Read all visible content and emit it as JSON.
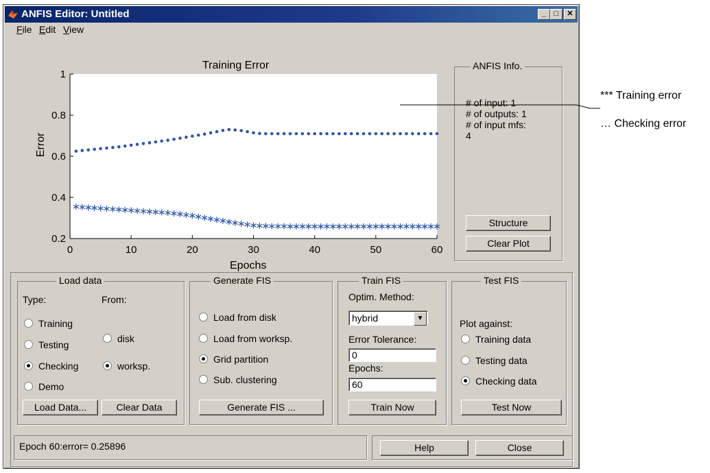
{
  "window": {
    "title": "ANFIS Editor: Untitled",
    "controls": {
      "minimize": "_",
      "maximize": "□",
      "close": "✕"
    }
  },
  "menu": [
    {
      "underline": "F",
      "rest": "ile"
    },
    {
      "underline": "E",
      "rest": "dit"
    },
    {
      "underline": "V",
      "rest": "iew"
    }
  ],
  "chart_data": {
    "type": "scatter",
    "title": "Training Error",
    "xlabel": "Epochs",
    "ylabel": "Error",
    "xlim": [
      0,
      60
    ],
    "ylim": [
      0.2,
      1
    ],
    "x_ticks": [
      "0",
      "10",
      "20",
      "30",
      "40",
      "50",
      "60"
    ],
    "y_ticks": [
      "0.2",
      "0.4",
      "0.6",
      "0.8",
      "1"
    ],
    "grid": false,
    "series": [
      {
        "marker": "dot",
        "color": "#2e55a8",
        "x": [
          1,
          2,
          3,
          4,
          5,
          6,
          7,
          8,
          9,
          10,
          11,
          12,
          13,
          14,
          15,
          16,
          17,
          18,
          19,
          20,
          21,
          22,
          23,
          24,
          25,
          26,
          27,
          28,
          29,
          30,
          31,
          32,
          33,
          34,
          35,
          36,
          37,
          38,
          39,
          40,
          41,
          42,
          43,
          44,
          45,
          46,
          47,
          48,
          49,
          50,
          51,
          52,
          53,
          54,
          55,
          56,
          57,
          58,
          59,
          60
        ],
        "values": [
          0.625,
          0.628,
          0.631,
          0.634,
          0.637,
          0.64,
          0.643,
          0.646,
          0.65,
          0.654,
          0.658,
          0.662,
          0.666,
          0.67,
          0.674,
          0.678,
          0.683,
          0.688,
          0.693,
          0.698,
          0.703,
          0.708,
          0.714,
          0.72,
          0.726,
          0.73,
          0.728,
          0.725,
          0.72,
          0.714,
          0.711,
          0.71,
          0.71,
          0.71,
          0.71,
          0.71,
          0.71,
          0.71,
          0.71,
          0.71,
          0.71,
          0.71,
          0.71,
          0.71,
          0.71,
          0.71,
          0.71,
          0.71,
          0.71,
          0.71,
          0.71,
          0.71,
          0.71,
          0.71,
          0.71,
          0.71,
          0.71,
          0.71,
          0.71,
          0.71
        ]
      },
      {
        "marker": "asterisk",
        "color": "#2e55a8",
        "x": [
          1,
          2,
          3,
          4,
          5,
          6,
          7,
          8,
          9,
          10,
          11,
          12,
          13,
          14,
          15,
          16,
          17,
          18,
          19,
          20,
          21,
          22,
          23,
          24,
          25,
          26,
          27,
          28,
          29,
          30,
          31,
          32,
          33,
          34,
          35,
          36,
          37,
          38,
          39,
          40,
          41,
          42,
          43,
          44,
          45,
          46,
          47,
          48,
          49,
          50,
          51,
          52,
          53,
          54,
          55,
          56,
          57,
          58,
          59,
          60
        ],
        "values": [
          0.355,
          0.353,
          0.351,
          0.349,
          0.347,
          0.345,
          0.343,
          0.341,
          0.339,
          0.337,
          0.335,
          0.333,
          0.331,
          0.329,
          0.327,
          0.325,
          0.322,
          0.319,
          0.315,
          0.311,
          0.306,
          0.301,
          0.296,
          0.291,
          0.286,
          0.281,
          0.276,
          0.272,
          0.268,
          0.264,
          0.262,
          0.261,
          0.26,
          0.26,
          0.26,
          0.259,
          0.259,
          0.259,
          0.259,
          0.259,
          0.259,
          0.259,
          0.259,
          0.259,
          0.259,
          0.259,
          0.259,
          0.259,
          0.259,
          0.259,
          0.259,
          0.259,
          0.259,
          0.259,
          0.259,
          0.259,
          0.259,
          0.259,
          0.259,
          0.259
        ]
      }
    ]
  },
  "anfis_info": {
    "title": "ANFIS Info.",
    "lines": [
      "# of input: 1",
      "# of outputs: 1",
      "# of input mfs:",
      "4"
    ],
    "structure_button": "Structure",
    "clear_plot_button": "Clear Plot"
  },
  "load_data": {
    "title": "Load data",
    "type_label": "Type:",
    "from_label": "From:",
    "type_options": [
      {
        "label": "Training",
        "selected": false
      },
      {
        "label": "Testing",
        "selected": false
      },
      {
        "label": "Checking",
        "selected": true
      },
      {
        "label": "Demo",
        "selected": false
      }
    ],
    "from_options": [
      {
        "label": "disk",
        "selected": false
      },
      {
        "label": "worksp.",
        "selected": true
      }
    ],
    "load_button": "Load Data...",
    "clear_button": "Clear Data"
  },
  "generate_fis": {
    "title": "Generate FIS",
    "options": [
      {
        "label": "Load from disk",
        "selected": false
      },
      {
        "label": "Load from worksp.",
        "selected": false
      },
      {
        "label": "Grid partition",
        "selected": true
      },
      {
        "label": "Sub. clustering",
        "selected": false
      }
    ],
    "button": "Generate FIS ..."
  },
  "train_fis": {
    "title": "Train FIS",
    "method_label": "Optim. Method:",
    "method_value": "hybrid",
    "tolerance_label": "Error Tolerance:",
    "tolerance_value": "0",
    "epochs_label": "Epochs:",
    "epochs_value": "60",
    "button": "Train Now"
  },
  "test_fis": {
    "title": "Test FIS",
    "plot_against_label": "Plot against:",
    "options": [
      {
        "label": "Training data",
        "selected": false
      },
      {
        "label": "Testing data",
        "selected": false
      },
      {
        "label": "Checking data",
        "selected": true
      }
    ],
    "button": "Test Now"
  },
  "status": {
    "text": "Epoch 60:error= 0.25896"
  },
  "footer": {
    "help_button": "Help",
    "close_button": "Close"
  },
  "annotations": {
    "training": "*** Training error",
    "checking": "… Checking error"
  }
}
